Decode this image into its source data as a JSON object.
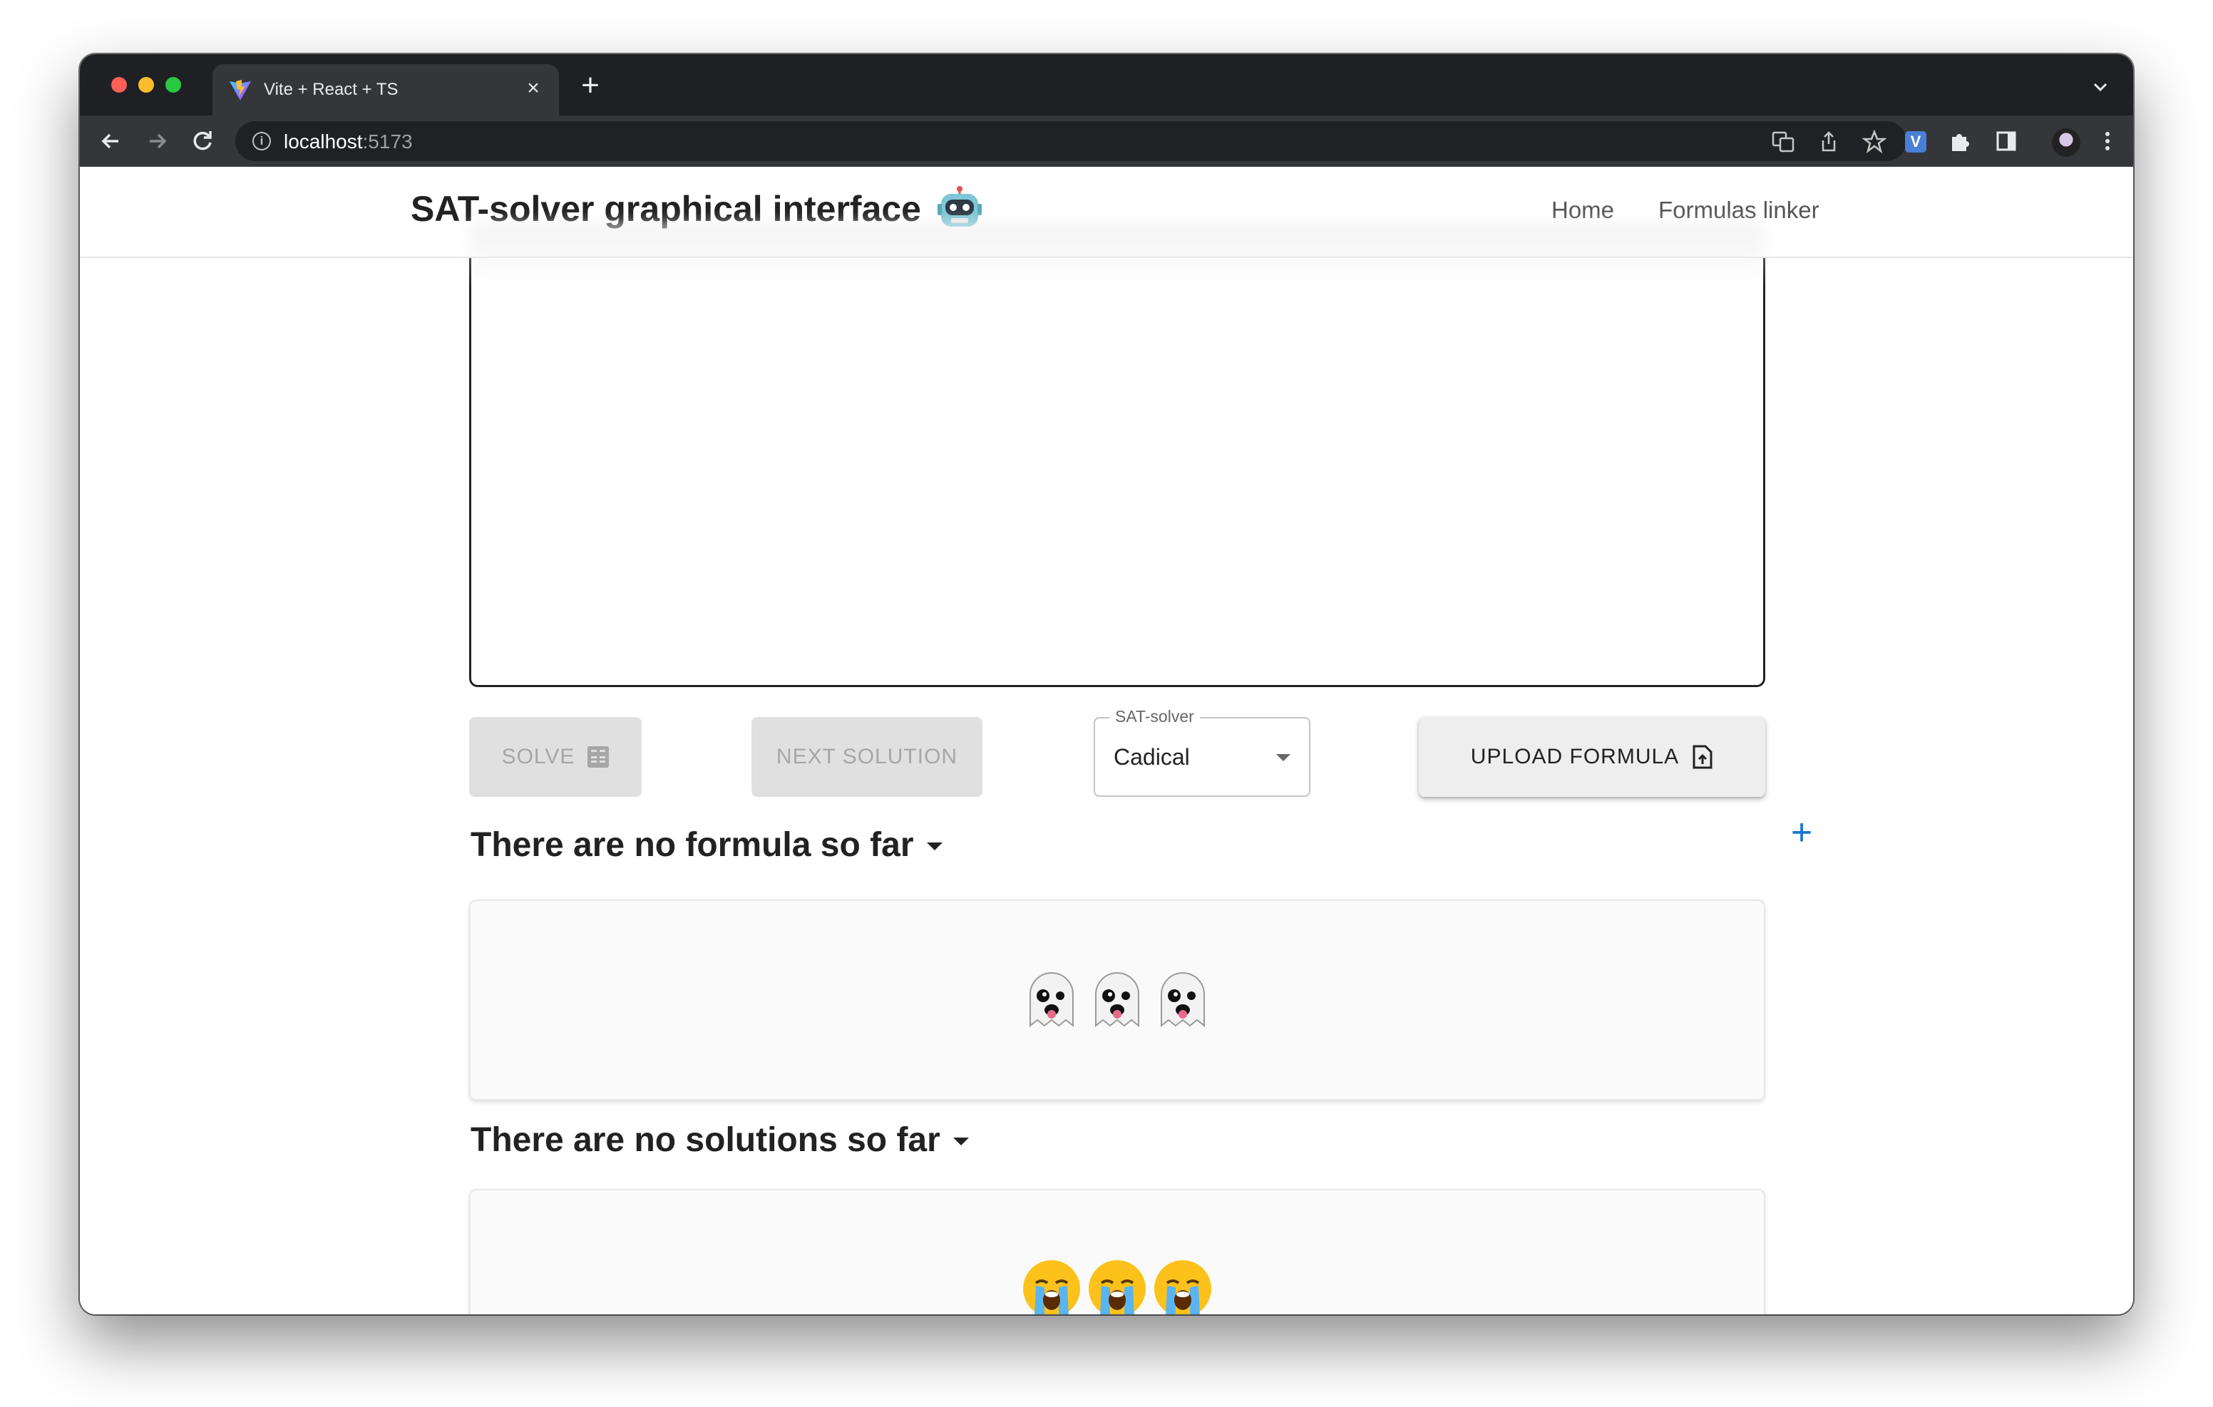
{
  "browser": {
    "tab_title": "Vite + React + TS",
    "tab_close": "×",
    "new_tab": "+",
    "url_host": "localhost",
    "url_port": ":5173"
  },
  "app": {
    "title": "SAT-solver graphical interface",
    "nav": [
      "Home",
      "Formulas linker"
    ]
  },
  "controls": {
    "solve_label": "SOLVE",
    "next_solution_label": "NEXT SOLUTION",
    "solver_label": "SAT-solver",
    "solver_value": "Cadical",
    "upload_label": "UPLOAD FORMULA"
  },
  "formulas": {
    "title": "There are no formula so far",
    "add": "+",
    "empty_icon": "ghost-emoji"
  },
  "solutions": {
    "title": "There are no solutions so far",
    "empty_icon": "crying-face-emoji"
  },
  "colors": {
    "accent": "#1976d2",
    "disabled_bg": "#e0e0e0",
    "disabled_text": "#a6a6a6"
  }
}
